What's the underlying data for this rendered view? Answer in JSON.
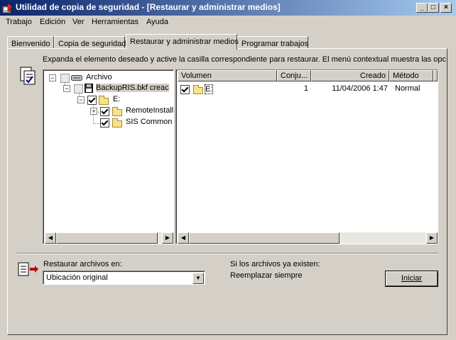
{
  "window": {
    "title": "Utilidad de copia de seguridad - [Restaurar y administrar medios]",
    "controls": {
      "minimize": "_",
      "maximize": "□",
      "close": "×"
    }
  },
  "menu": [
    {
      "label": "Trabajo",
      "key": "T"
    },
    {
      "label": "Edición",
      "key": "E"
    },
    {
      "label": "Ver",
      "key": "V"
    },
    {
      "label": "Herramientas",
      "key": "r"
    },
    {
      "label": "Ayuda",
      "key": "y"
    }
  ],
  "tabs": [
    {
      "label": "Bienvenido"
    },
    {
      "label": "Copia de seguridad"
    },
    {
      "label": "Restaurar y administrar medios",
      "active": true
    },
    {
      "label": "Programar trabajos"
    }
  ],
  "instructions": "Expanda el elemento deseado y active la casilla correspondiente para restaurar. El menú contextual muestra las opciones",
  "tree": {
    "root": "Archivo",
    "backup": "BackupRIS.bkf creac",
    "drive": "E:",
    "folders": [
      "RemoteInstall",
      "SIS Common"
    ]
  },
  "list": {
    "columns": [
      "Volumen",
      "Conju...",
      "Creado",
      "Método"
    ],
    "rows": [
      {
        "volume": "E:",
        "set": "1",
        "created": "11/04/2006 1:47",
        "method": "Normal"
      }
    ]
  },
  "restore": {
    "label": "Restaurar archivos en:",
    "label_key": "R",
    "selected": "Ubicación original",
    "exists_label": "Si los archivos ya existen:",
    "exists_value": "Reemplazar siempre",
    "start_button": "Iniciar",
    "start_key": "I"
  },
  "icons": {
    "app": "backup-app-icon",
    "restore": "restore-wizard-icon",
    "destination": "restore-destination-icon"
  }
}
